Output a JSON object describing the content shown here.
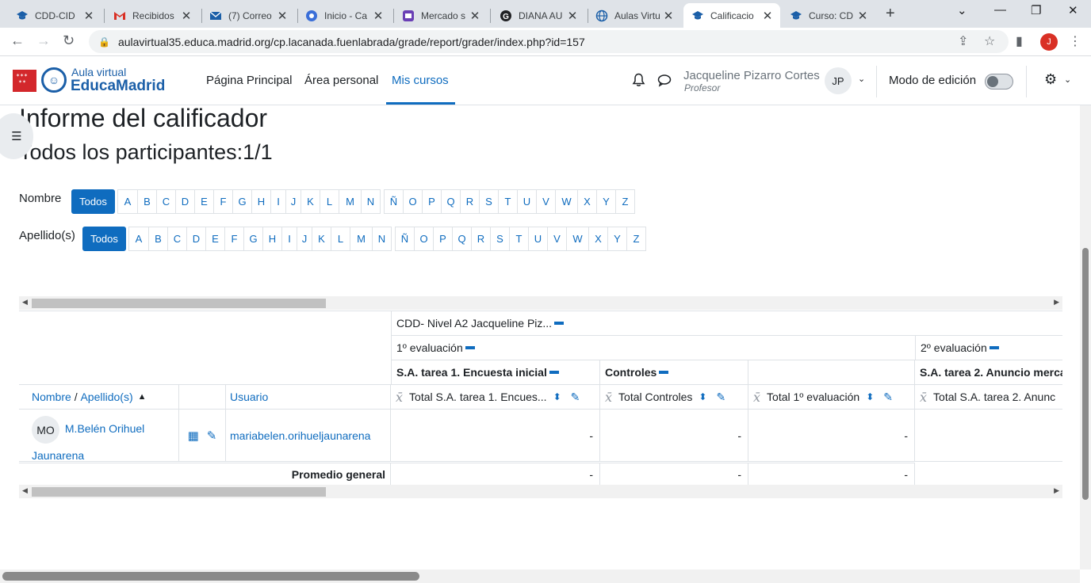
{
  "browser": {
    "tabs": [
      {
        "label": "CDD-CID",
        "icon": "graduation-cap-icon"
      },
      {
        "label": "Recibidos",
        "icon": "gmail-icon"
      },
      {
        "label": "(7) Correo",
        "icon": "mail-icon"
      },
      {
        "label": "Inicio - Ca",
        "icon": "compass-icon"
      },
      {
        "label": "Mercado s",
        "icon": "store-icon"
      },
      {
        "label": "DIANA AU",
        "icon": "google-icon"
      },
      {
        "label": "Aulas Virtu",
        "icon": "globe-icon"
      },
      {
        "label": "Calificacio",
        "icon": "graduation-cap-icon"
      },
      {
        "label": "Curso: CD",
        "icon": "graduation-cap-icon"
      }
    ],
    "url": "aulavirtual35.educa.madrid.org/cp.lacanada.fuenlabrada/grade/report/grader/index.php?id=157",
    "profile_initial": "J"
  },
  "navbar": {
    "logo_small": "Aula virtual",
    "logo_big": "EducaMadrid",
    "links": [
      "Página Principal",
      "Área personal",
      "Mis cursos"
    ],
    "user_name": "Jacqueline Pizarro Cortes",
    "user_role": "Profesor",
    "user_initials": "JP",
    "edit_mode_label": "Modo de edición"
  },
  "page": {
    "title": "Informe del calificador",
    "subtitle": "Todos los participantes:1/1"
  },
  "filters": {
    "first_name_label": "Nombre",
    "last_name_label": "Apellido(s)",
    "all_label": "Todos",
    "letters_a": [
      "A",
      "B",
      "C",
      "D",
      "E",
      "F",
      "G",
      "H",
      "I",
      "J",
      "K",
      "L",
      "M",
      "N"
    ],
    "letters_b": [
      "Ñ",
      "O",
      "P",
      "Q",
      "R",
      "S",
      "T",
      "U",
      "V",
      "W",
      "X",
      "Y",
      "Z"
    ]
  },
  "grader": {
    "course": "CDD- Nivel A2 Jacqueline Piz...",
    "cat1": "1º evaluación",
    "cat2": "2º evaluación",
    "sub1": "S.A. tarea 1. Encuesta inicial",
    "sub2": "Controles",
    "sub3": "S.A. tarea 2. Anuncio merca",
    "col_name": "Nombre",
    "col_slash": "/",
    "col_lastname": "Apellido(s)",
    "col_user": "Usuario",
    "col_total1": "Total S.A. tarea 1. Encues...",
    "col_total2": "Total Controles",
    "col_total3": "Total 1º evaluación",
    "col_total4": "Total S.A. tarea 2. Anunc",
    "student": {
      "initials": "MO",
      "name_line1": "M.Belén Orihuel",
      "name_line2": "Jaunarena",
      "username": "mariabelen.orihueljaunarena",
      "grades": [
        "-",
        "-",
        "-"
      ]
    },
    "overall_label": "Promedio general",
    "overall": [
      "-",
      "-",
      "-"
    ]
  }
}
